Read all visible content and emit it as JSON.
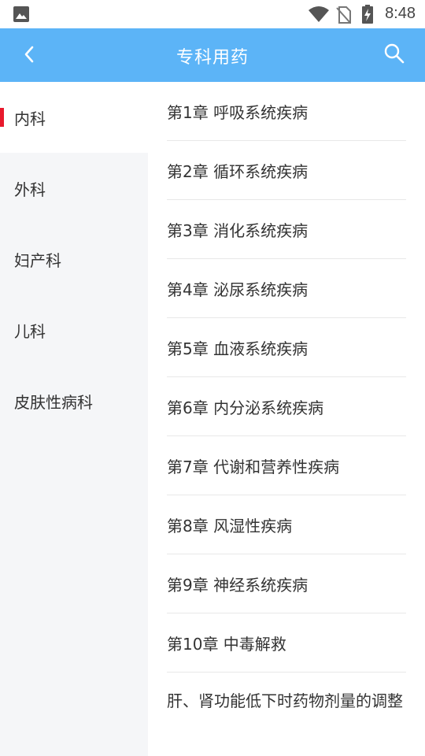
{
  "status_bar": {
    "time": "8:48",
    "icons": [
      "gallery-icon",
      "wifi-icon",
      "no-sim-icon",
      "battery-charging-icon"
    ]
  },
  "header": {
    "title": "专科用药",
    "back_icon": "chevron-left-icon",
    "search_icon": "search-icon",
    "background_color": "#5cb4f7"
  },
  "sidebar": {
    "accent_color": "#e8192c",
    "items": [
      {
        "label": "内科",
        "active": true
      },
      {
        "label": "外科",
        "active": false
      },
      {
        "label": "妇产科",
        "active": false
      },
      {
        "label": "儿科",
        "active": false
      },
      {
        "label": "皮肤性病科",
        "active": false
      }
    ]
  },
  "chapters": [
    {
      "label": "第1章 呼吸系统疾病"
    },
    {
      "label": "第2章 循环系统疾病"
    },
    {
      "label": "第3章 消化系统疾病"
    },
    {
      "label": "第4章 泌尿系统疾病"
    },
    {
      "label": "第5章 血液系统疾病"
    },
    {
      "label": "第6章 内分泌系统疾病"
    },
    {
      "label": "第7章 代谢和营养性疾病"
    },
    {
      "label": "第8章 风湿性疾病"
    },
    {
      "label": "第9章 神经系统疾病"
    },
    {
      "label": "第10章 中毒解救"
    },
    {
      "label": "肝、肾功能低下时药物剂量的调整"
    }
  ]
}
